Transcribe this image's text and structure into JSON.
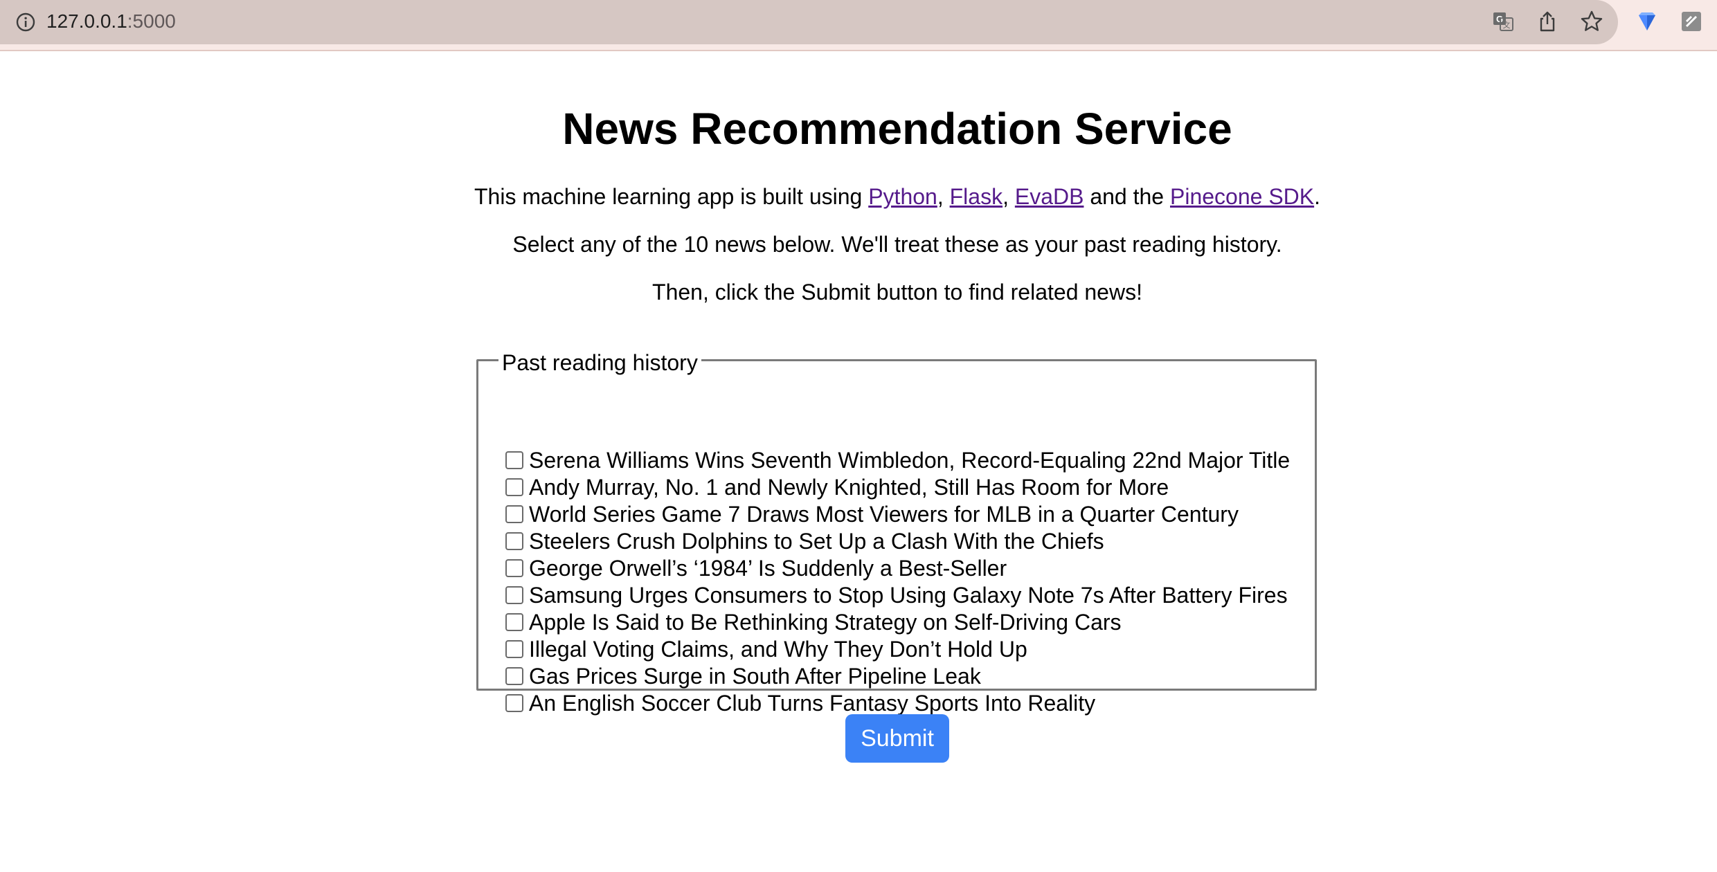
{
  "browser": {
    "url_host": "127.0.0.1",
    "url_port": ":5000"
  },
  "page": {
    "title": "News Recommendation Service",
    "intro": {
      "before": "This machine learning app is built using ",
      "links": [
        "Python",
        "Flask",
        "EvaDB",
        "Pinecone SDK"
      ],
      "sep1": ", ",
      "sep2": ", ",
      "sep3": " and the ",
      "after": "."
    },
    "instructions_1": "Select any of the 10 news below. We'll treat these as your past reading history.",
    "instructions_2": "Then, click the Submit button to find related news!"
  },
  "history": {
    "legend": "Past reading history",
    "items": [
      {
        "label": "Serena Williams Wins Seventh Wimbledon, Record-Equaling 22nd Major Title",
        "checked": false
      },
      {
        "label": "Andy Murray, No. 1 and Newly Knighted, Still Has Room for More",
        "checked": false
      },
      {
        "label": "World Series Game 7 Draws Most Viewers for MLB in a Quarter Century",
        "checked": false
      },
      {
        "label": "Steelers Crush Dolphins to Set Up a Clash With the Chiefs",
        "checked": false
      },
      {
        "label": "George Orwell’s ‘1984’ Is Suddenly a Best-Seller",
        "checked": false
      },
      {
        "label": "Samsung Urges Consumers to Stop Using Galaxy Note 7s After Battery Fires",
        "checked": false
      },
      {
        "label": "Apple Is Said to Be Rethinking Strategy on Self-Driving Cars",
        "checked": false
      },
      {
        "label": "Illegal Voting Claims, and Why They Don’t Hold Up",
        "checked": false
      },
      {
        "label": "Gas Prices Surge in South After Pipeline Leak",
        "checked": false
      },
      {
        "label": "An English Soccer Club Turns Fantasy Sports Into Reality",
        "checked": false
      }
    ]
  },
  "form": {
    "submit_label": "Submit"
  },
  "colors": {
    "toolbar_bg": "#f8e9e6",
    "omnibox_bg": "#d6c7c3",
    "link_visited": "#551a8b",
    "button_bg": "#3b82f6"
  },
  "icons": [
    "info-icon",
    "translate-icon",
    "share-icon",
    "bookmark-star-icon",
    "extension-diamond-icon",
    "extension-menu-icon"
  ]
}
